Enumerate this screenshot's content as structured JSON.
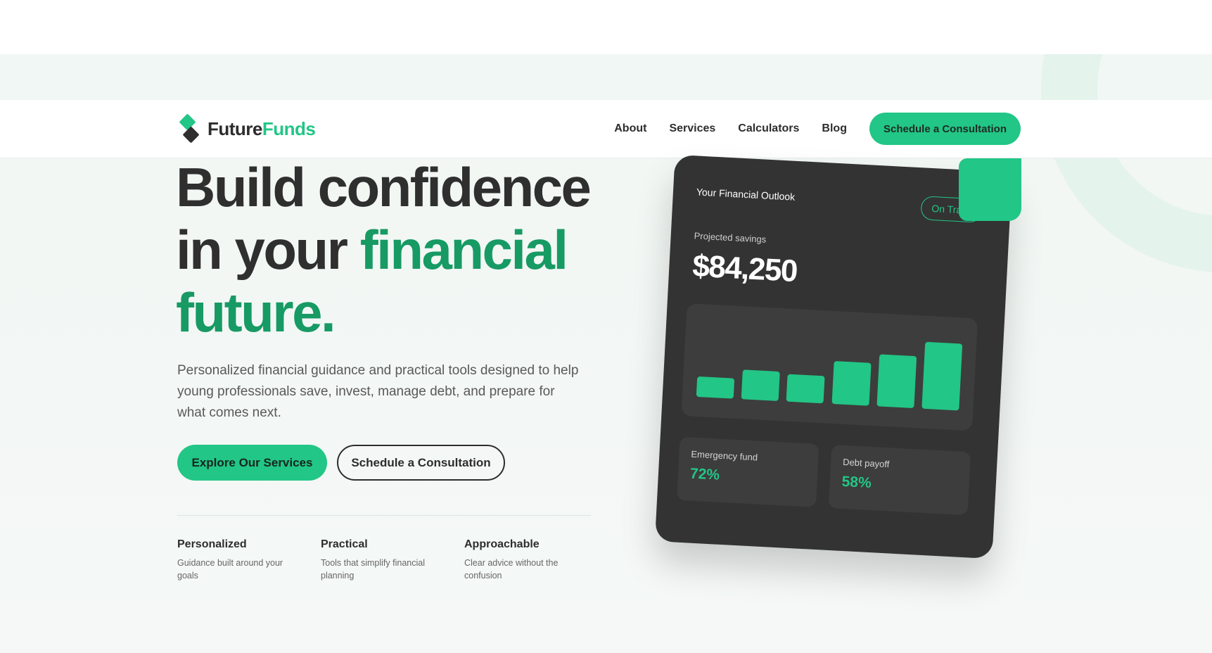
{
  "brand": {
    "name_part1": "Future",
    "name_part2": "Funds",
    "accent_color": "#22c686"
  },
  "nav": {
    "links": [
      "About",
      "Services",
      "Calculators",
      "Blog"
    ],
    "cta_label": "Schedule a Consultation"
  },
  "hero": {
    "headline_line1": "Build confidence",
    "headline_line2_plain": "in your ",
    "headline_line2_green": "financial",
    "headline_line3_green": "future.",
    "subtext": "Personalized financial guidance and practical tools designed to help young professionals save, invest, manage debt, and prepare for what comes next.",
    "primary_button": "Explore Our Services",
    "secondary_button": "Schedule a Consultation"
  },
  "features": [
    {
      "title": "Personalized",
      "desc": "Guidance built around your goals"
    },
    {
      "title": "Practical",
      "desc": "Tools that simplify financial planning"
    },
    {
      "title": "Approachable",
      "desc": "Clear advice without the confusion"
    }
  ],
  "card": {
    "title": "Your Financial Outlook",
    "badge": "On Track",
    "projected_label": "Projected savings",
    "projected_value": "$84,250",
    "bar_levels": [
      0.28,
      0.4,
      0.37,
      0.58,
      0.7,
      0.9
    ],
    "stats": [
      {
        "label": "Emergency fund",
        "value": "72%"
      },
      {
        "label": "Debt payoff",
        "value": "58%"
      }
    ]
  }
}
